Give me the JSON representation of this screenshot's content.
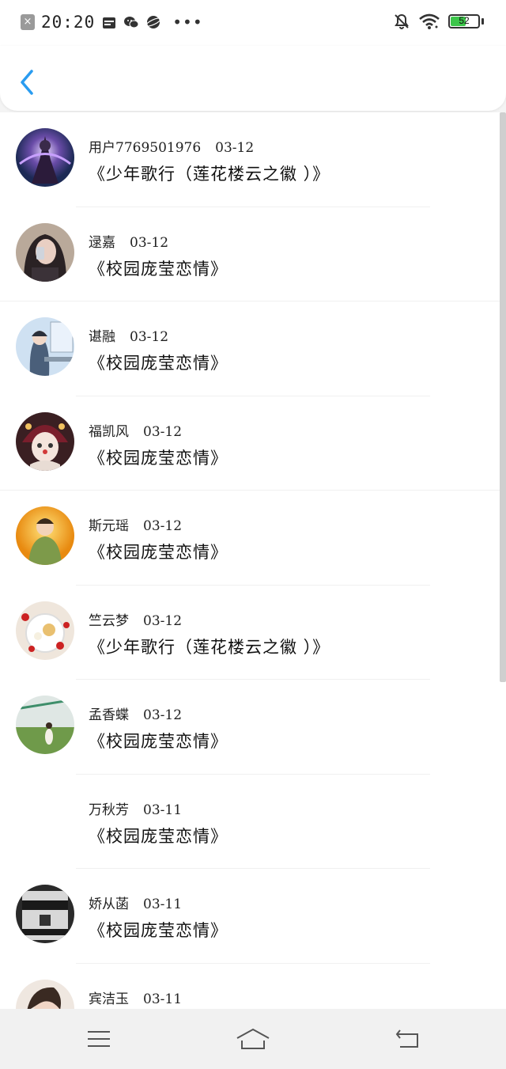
{
  "status_bar": {
    "time": "20:20",
    "battery": "52",
    "battery_level": 0.52,
    "battery_color": "#3cc54a",
    "icons": [
      "close-icon",
      "calendar-icon",
      "wechat-icon",
      "planet-icon",
      "more-dots-icon",
      "bell-off-icon",
      "wifi-icon",
      "battery-icon"
    ]
  },
  "header": {
    "back_icon": "chevron-left-icon",
    "accent": "#2a9cf0"
  },
  "items": [
    {
      "user": "用户7769501976",
      "date": "03-12",
      "title": "《少年歌行（莲花楼云之徽 ）》",
      "avatar": "fantasy-figure"
    },
    {
      "user": "逯嘉",
      "date": "03-12",
      "title": "《校园庞莹恋情》",
      "avatar": "selfie-girl"
    },
    {
      "user": "谌融",
      "date": "03-12",
      "title": "《校园庞莹恋情》",
      "avatar": "girl-at-desk"
    },
    {
      "user": "福凯风",
      "date": "03-12",
      "title": "《校园庞莹恋情》",
      "avatar": "clown-girl"
    },
    {
      "user": "斯元瑶",
      "date": "03-12",
      "title": "《校园庞莹恋情》",
      "avatar": "young-man-yellow"
    },
    {
      "user": "竺云梦",
      "date": "03-12",
      "title": "《少年歌行（莲花楼云之徽 ）》",
      "avatar": "dessert-bowl"
    },
    {
      "user": "孟香蝶",
      "date": "03-12",
      "title": "《校园庞莹恋情》",
      "avatar": "girl-in-field"
    },
    {
      "user": "万秋芳",
      "date": "03-11",
      "title": "《校园庞莹恋情》",
      "avatar": ""
    },
    {
      "user": "娇从菡",
      "date": "03-11",
      "title": "《校园庞莹恋情》",
      "avatar": "arsenic-bottle"
    },
    {
      "user": "宾洁玉",
      "date": "03-11",
      "title": "",
      "avatar": "girl-portrait"
    }
  ],
  "navbar": {
    "icons": [
      "menu-icon",
      "home-icon",
      "back-icon"
    ]
  }
}
